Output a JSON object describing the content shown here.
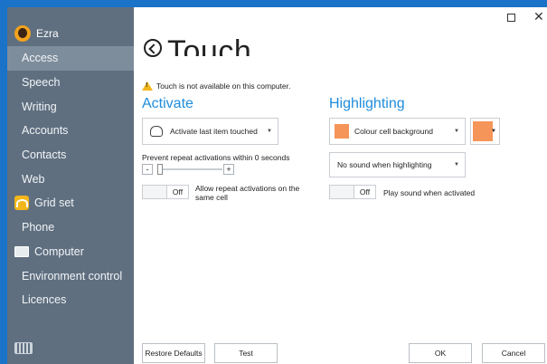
{
  "window": {
    "close_glyph": "✕"
  },
  "sidebar": {
    "user_name": "Ezra",
    "items": [
      {
        "label": "Access",
        "active": true
      },
      {
        "label": "Speech"
      },
      {
        "label": "Writing"
      },
      {
        "label": "Accounts"
      },
      {
        "label": "Contacts"
      },
      {
        "label": "Web"
      },
      {
        "label": "Grid set",
        "icon": "grid-set-icon"
      },
      {
        "label": "Phone"
      },
      {
        "label": "Computer",
        "icon": "computer-icon"
      },
      {
        "label": "Environment control"
      },
      {
        "label": "Licences"
      }
    ],
    "footer_icon": "keyboard-icon"
  },
  "page": {
    "title": "Touch",
    "warning": "Touch is not available on this computer."
  },
  "activate": {
    "heading": "Activate",
    "mode_value": "Activate last item touched",
    "prevent_label": "Prevent repeat activations within 0 seconds",
    "stepper_minus": "-",
    "stepper_plus": "+",
    "repeat_toggle_state": "Off",
    "repeat_toggle_label": "Allow repeat activations on the same cell"
  },
  "highlighting": {
    "heading": "Highlighting",
    "style_value": "Colour cell background",
    "colour": "#f5955a",
    "sound_value": "No sound when highlighting",
    "sound_toggle_state": "Off",
    "sound_toggle_label": "Play sound when activated"
  },
  "footer": {
    "restore": "Restore Defaults",
    "test": "Test",
    "ok": "OK",
    "cancel": "Cancel"
  },
  "colors": {
    "accent": "#1f8cdc",
    "sidebar": "#5f6f80",
    "sidebar_active": "#7e8d9c"
  }
}
